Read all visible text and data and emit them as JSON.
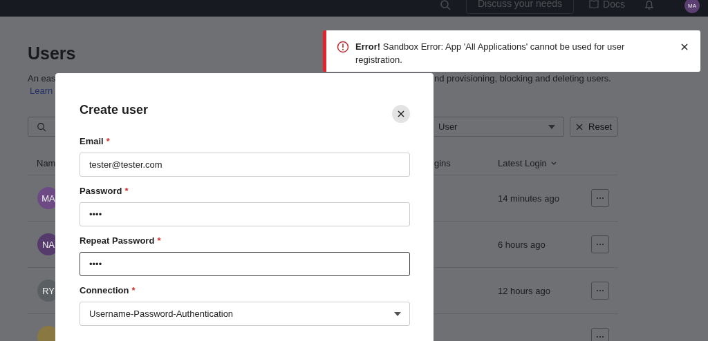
{
  "top_bar": {
    "discuss_button": "Discuss your needs",
    "docs_link": "Docs",
    "avatar": "MA"
  },
  "page": {
    "title": "Users",
    "description_start": "An eas",
    "description_end": "nd provisioning, blocking and deleting users.",
    "learn_link": "Learn",
    "role_filter": "User",
    "reset_button": "Reset",
    "columns": [
      "Nam",
      "gins",
      "Latest Login"
    ],
    "rows": [
      {
        "initials": "MA",
        "color": "#6e4a85",
        "latest_login": "14 minutes ago"
      },
      {
        "initials": "NA",
        "color": "#553a6c",
        "latest_login": "6 hours ago"
      },
      {
        "initials": "RY",
        "color": "#5a5f63",
        "latest_login": "12 hours ago"
      },
      {
        "color": "#8a7842"
      }
    ]
  },
  "modal": {
    "title": "Create user",
    "fields": [
      {
        "label": "Email",
        "required_mark": "*",
        "kind": "text",
        "value": "tester@tester.com",
        "focused": false
      },
      {
        "label": "Password",
        "required_mark": "*",
        "kind": "text",
        "value": "••••",
        "focused": false
      },
      {
        "label": "Repeat Password",
        "required_mark": "*",
        "kind": "text",
        "value": "••••",
        "focused": true
      },
      {
        "label": "Connection",
        "required_mark": "*",
        "kind": "select",
        "value": "Username-Password-Authentication",
        "focused": false
      }
    ]
  },
  "toast": {
    "text": "**Error!** Sandbox Error: App 'All Applications' cannot be used for user registration."
  }
}
